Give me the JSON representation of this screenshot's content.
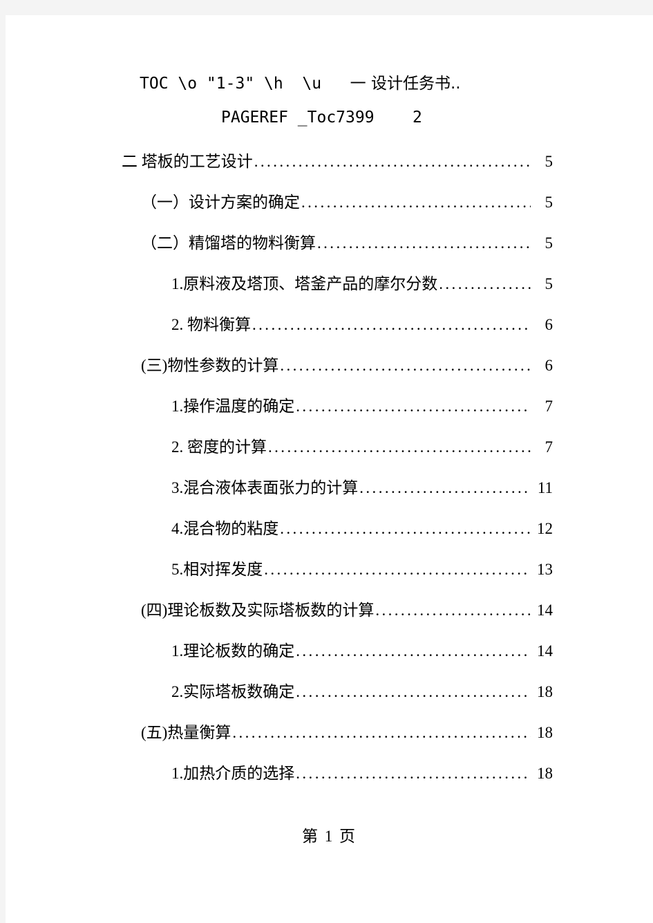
{
  "document": {
    "background_color": "#f4f4f4",
    "page_color": "#ffffff",
    "text_color": "#000000"
  },
  "field_code": {
    "line1_ascii": "TOC \\o \"1-3\" \\h  \\u   ",
    "line1_cjk": "一 设计任务书..",
    "line2": "PAGEREF _Toc7399    2"
  },
  "toc": {
    "entries": [
      {
        "level": 1,
        "label": "二 塔板的工艺设计",
        "page": "5"
      },
      {
        "level": 2,
        "label": "（一）设计方案的确定",
        "page": "5"
      },
      {
        "level": 2,
        "label": "（二）精馏塔的物料衡算",
        "page": "5"
      },
      {
        "level": 3,
        "label": "1.原料液及塔顶、塔釜产品的摩尔分数",
        "page": "5"
      },
      {
        "level": 3,
        "label": "2. 物料衡算",
        "page": "6"
      },
      {
        "level": 2,
        "label": "(三)物性参数的计算",
        "page": "6"
      },
      {
        "level": 3,
        "label": "1.操作温度的确定",
        "page": "7"
      },
      {
        "level": 3,
        "label": "2. 密度的计算",
        "page": "7"
      },
      {
        "level": 3,
        "label": "3.混合液体表面张力的计算",
        "page": "11"
      },
      {
        "level": 3,
        "label": "4.混合物的粘度",
        "page": "12"
      },
      {
        "level": 3,
        "label": "5.相对挥发度",
        "page": "13"
      },
      {
        "level": 2,
        "label": "(四)理论板数及实际塔板数的计算",
        "page": "14"
      },
      {
        "level": 3,
        "label": "1.理论板数的确定",
        "page": "14"
      },
      {
        "level": 3,
        "label": "2.实际塔板数确定",
        "page": "18"
      },
      {
        "level": 2,
        "label": "(五)热量衡算",
        "page": "18"
      },
      {
        "level": 3,
        "label": "1.加热介质的选择",
        "page": "18"
      }
    ]
  },
  "footer": {
    "text": "第 1 页"
  }
}
